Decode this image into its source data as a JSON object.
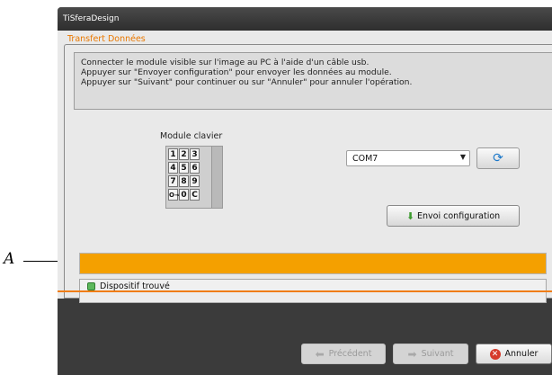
{
  "annotation": {
    "letter": "A"
  },
  "window": {
    "title": "TiSferaDesign"
  },
  "section": {
    "legend": "Transfert Données"
  },
  "instructions": {
    "line1": "Connecter le module visible sur l'image au PC à l'aide d'un câble usb.",
    "line2": "Appuyer sur \"Envoyer configuration\" pour envoyer les données au module.",
    "line3": "Appuyer sur \"Suivant\" pour continuer ou sur \"Annuler\" pour annuler l'opération."
  },
  "module": {
    "label": "Module clavier",
    "keys": [
      "1",
      "2",
      "3",
      "4",
      "5",
      "6",
      "7",
      "8",
      "9",
      "O⊸",
      "0",
      "C"
    ]
  },
  "port": {
    "selected": "COM7"
  },
  "buttons": {
    "envoi": "Envoi configuration",
    "prev": "Précédent",
    "next": "Suivant",
    "cancel": "Annuler"
  },
  "status": {
    "text": "Dispositif trouvé"
  },
  "colors": {
    "accent": "#e97800",
    "progress": "#f4a000",
    "ok": "#5cb85c"
  },
  "icons": {
    "refresh": "refresh-icon",
    "envoi": "upload-icon",
    "prev": "arrow-left-icon",
    "next": "arrow-right-icon",
    "cancel": "cancel-icon",
    "status": "ok-status-icon"
  }
}
